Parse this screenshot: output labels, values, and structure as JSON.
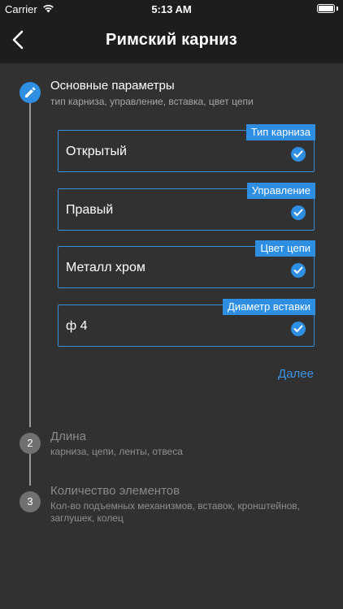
{
  "status_bar": {
    "carrier": "Carrier",
    "time": "5:13 AM"
  },
  "nav": {
    "title": "Римский карниз"
  },
  "steps": [
    {
      "number": "",
      "title": "Основные параметры",
      "subtitle": "тип карниза, управление, вставка, цвет цепи",
      "fields": [
        {
          "tag": "Тип карниза",
          "value": "Открытый"
        },
        {
          "tag": "Управление",
          "value": "Правый"
        },
        {
          "tag": "Цвет цепи",
          "value": "Металл хром"
        },
        {
          "tag": "Диаметр вставки",
          "value": "ф 4"
        }
      ],
      "next_label": "Далее"
    },
    {
      "number": "2",
      "title": "Длина",
      "subtitle": "карниза, цепи, ленты, отвеса"
    },
    {
      "number": "3",
      "title": "Количество элементов",
      "subtitle_line1": "Кол-во подъемных механизмов, вставок, кронштейнов,",
      "subtitle_line2": "заглушек, колец"
    }
  ],
  "colors": {
    "accent": "#2d8ee2",
    "background": "#313131",
    "topbar": "#1d1d1d"
  }
}
